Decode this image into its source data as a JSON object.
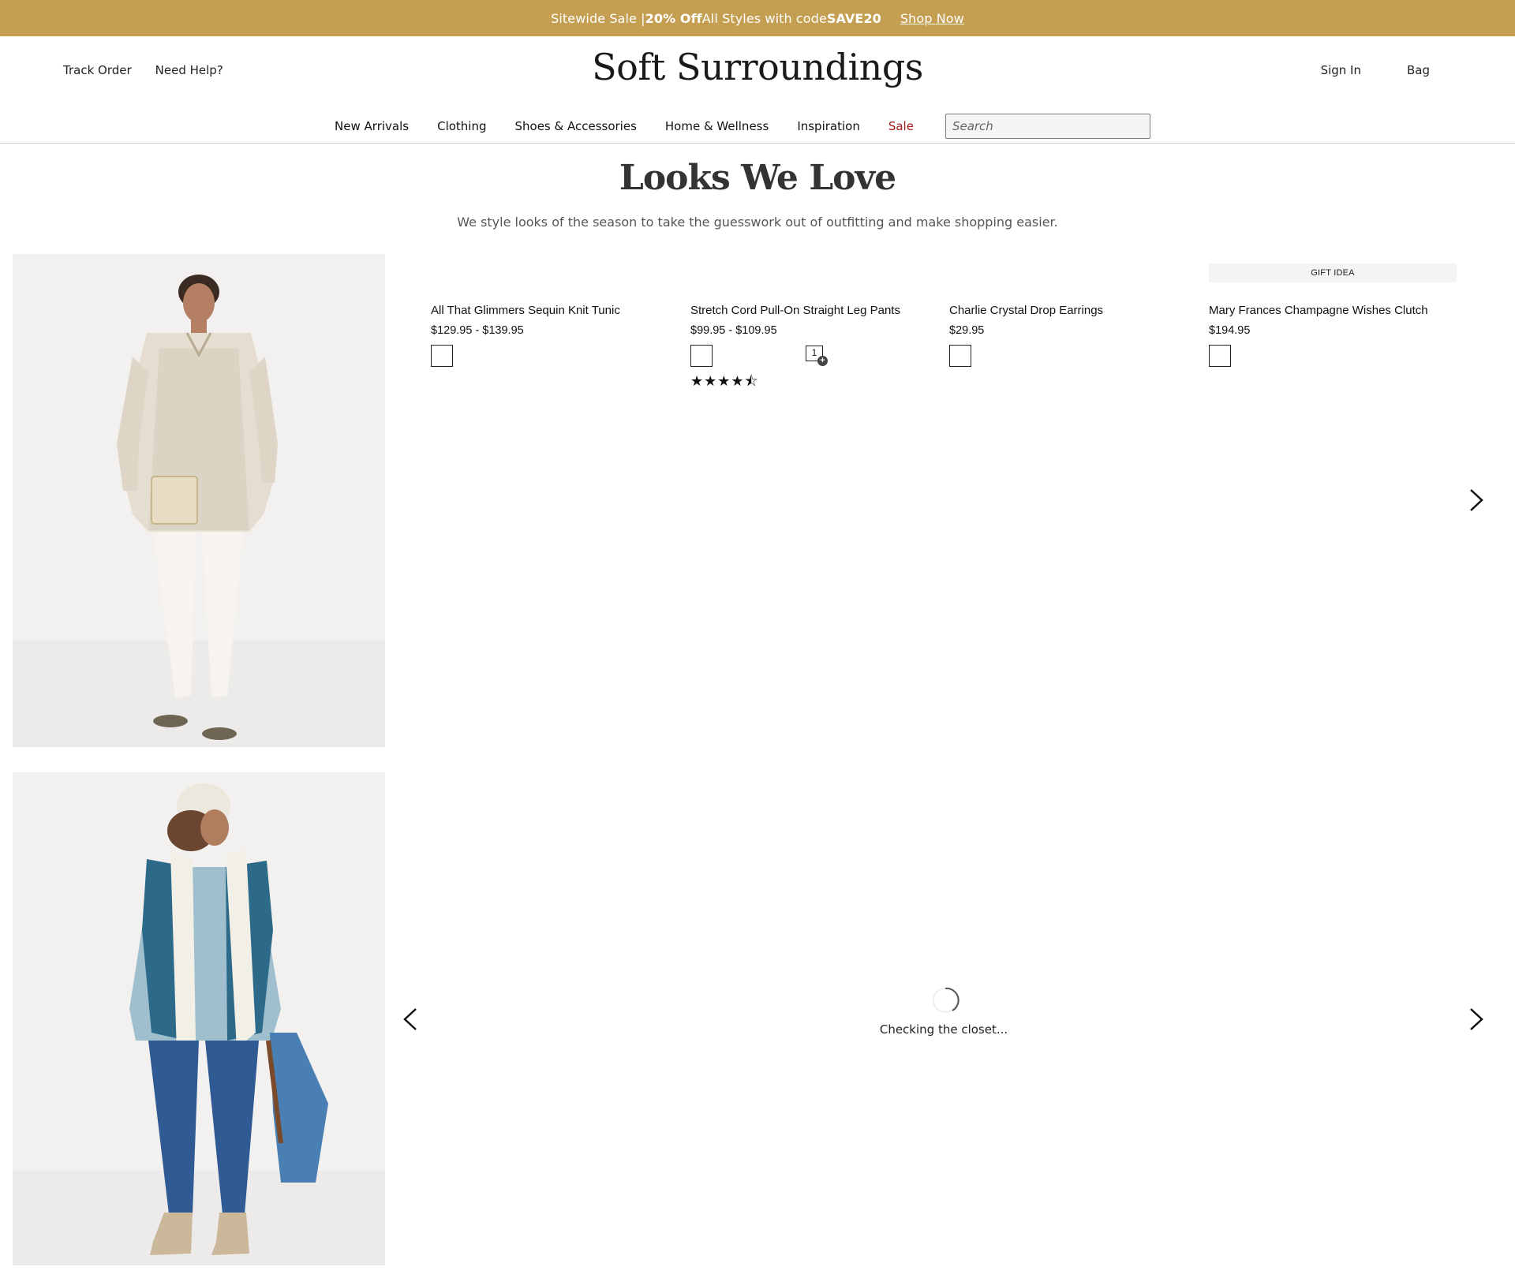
{
  "promo": {
    "prefix": "Sitewide Sale | ",
    "highlight": "20% Off",
    "middle": " All Styles with code ",
    "code": "SAVE20",
    "cta": "Shop Now",
    "bg_color": "#c49f52"
  },
  "header": {
    "track_order": "Track Order",
    "need_help": "Need Help?",
    "logo": "Soft Surroundings",
    "sign_in": "Sign In",
    "bag": "Bag"
  },
  "nav": {
    "items": [
      "New Arrivals",
      "Clothing",
      "Shoes & Accessories",
      "Home & Wellness",
      "Inspiration",
      "Sale"
    ],
    "sale_color": "#a01818",
    "search_placeholder": "Search"
  },
  "page": {
    "title": "Looks We Love",
    "subtitle": "We style looks of the season to take the guesswork out of outfitting and make shopping easier."
  },
  "looks": [
    {
      "products": [
        {
          "badge": "",
          "name": "All That Glimmers Sequin Knit Tunic",
          "price": "$129.95 - $139.95"
        },
        {
          "badge": "",
          "name": "Stretch Cord Pull-On Straight Leg Pants",
          "price": "$99.95 - $109.95",
          "qty_badge": "1",
          "rating": 4.5,
          "stars_glyph": "★★★★⯪"
        },
        {
          "badge": "",
          "name": "Charlie Crystal Drop Earrings",
          "price": "$29.95"
        },
        {
          "badge": "GIFT IDEA",
          "name": "Mary Frances Champagne Wishes Clutch",
          "price": "$194.95"
        }
      ]
    },
    {
      "loading_text": "Checking the closet..."
    }
  ],
  "icons": {
    "next": "chevron-right-icon",
    "prev": "chevron-left-icon",
    "spinner": "loading-spinner-icon",
    "qty": "quantity-add-icon",
    "qty_plus": "+"
  }
}
